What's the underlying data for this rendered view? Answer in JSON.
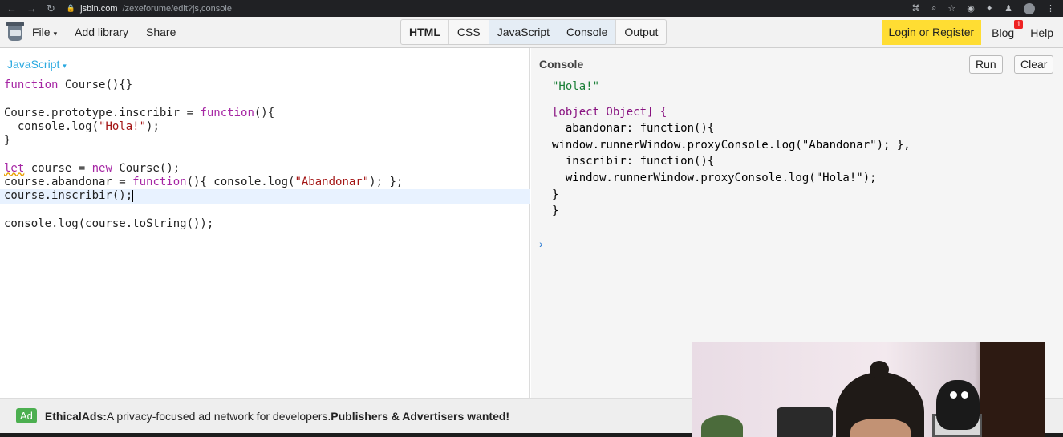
{
  "browser": {
    "url_domain": "jsbin.com",
    "url_path": "/zexeforume/edit?js,console"
  },
  "toolbar": {
    "menu": [
      {
        "label": "File",
        "caret": "▾"
      },
      {
        "label": "Add library"
      },
      {
        "label": "Share"
      }
    ],
    "panels": [
      {
        "label": "HTML",
        "active": false
      },
      {
        "label": "CSS",
        "active": false
      },
      {
        "label": "JavaScript",
        "active": true
      },
      {
        "label": "Console",
        "active": true
      },
      {
        "label": "Output",
        "active": false
      }
    ],
    "login_label": "Login or Register",
    "blog_label": "Blog",
    "blog_badge": "1",
    "help_label": "Help"
  },
  "editor": {
    "panel_label": "JavaScript",
    "lines": [
      "function Course(){}",
      "",
      "Course.prototype.inscribir = function(){",
      "  console.log(\"Hola!\");",
      "}",
      "",
      "let course = new Course();",
      "course.abandonar = function(){ console.log(\"Abandonar\"); };",
      "course.inscribir();",
      "",
      "console.log(course.toString());"
    ],
    "active_line": 8
  },
  "console": {
    "panel_label": "Console",
    "run_label": "Run",
    "clear_label": "Clear",
    "output_1": "\"Hola!\"",
    "output_2_lines": [
      "[object Object] {",
      "  abandonar: function(){",
      "window.runnerWindow.proxyConsole.log(\"Abandonar\"); },",
      "  inscribir: function(){",
      "  window.runnerWindow.proxyConsole.log(\"Hola!\");",
      "}",
      "}"
    ],
    "prompt": "›"
  },
  "ad": {
    "tag": "Ad",
    "brand": "EthicalAds:",
    "text": " A privacy-focused ad network for developers. ",
    "cta": "Publishers & Advertisers wanted!"
  },
  "colors": {
    "login_bg": "#ffdd33",
    "panel_label": "#2aa9e0",
    "ad_tag": "#4caf50"
  }
}
